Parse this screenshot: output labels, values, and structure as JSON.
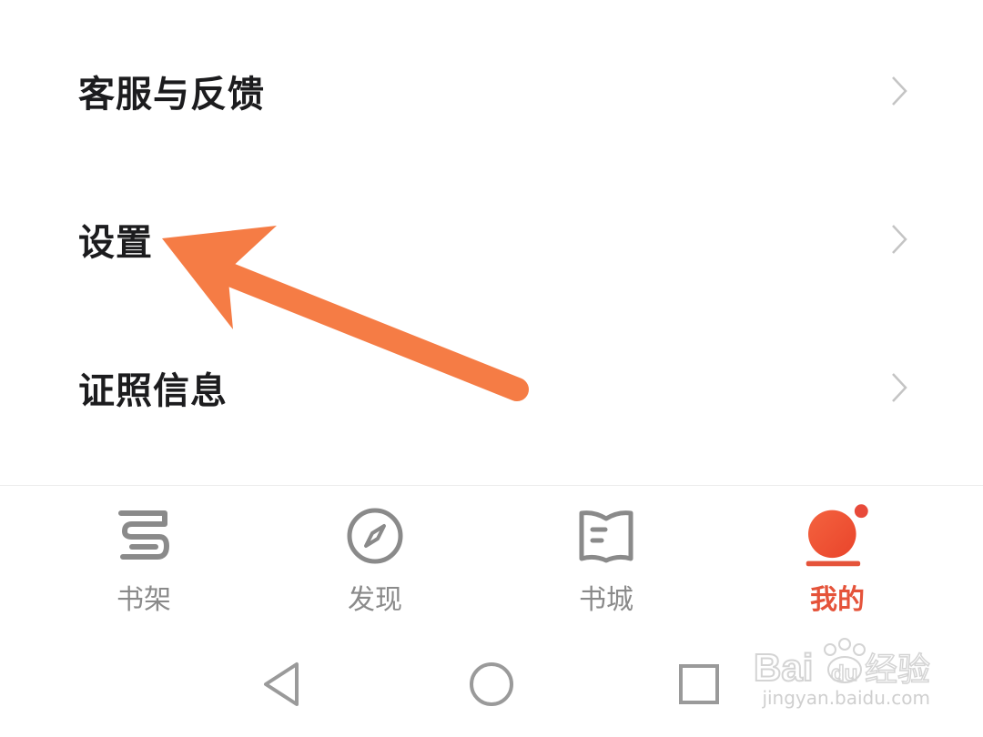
{
  "menu": {
    "items": [
      {
        "label": "客服与反馈"
      },
      {
        "label": "设置"
      },
      {
        "label": "证照信息"
      }
    ]
  },
  "tabs": [
    {
      "label": "书架",
      "icon": "bookshelf-icon",
      "active": false
    },
    {
      "label": "发现",
      "icon": "compass-icon",
      "active": false
    },
    {
      "label": "书城",
      "icon": "book-store-icon",
      "active": false
    },
    {
      "label": "我的",
      "icon": "profile-icon",
      "active": true
    }
  ],
  "colors": {
    "accent": "#e5533a",
    "arrow": "#f57c45",
    "inactive": "#8a8a8a",
    "text": "#1c1c1e"
  },
  "system_nav": [
    "back-icon",
    "home-icon",
    "recents-icon"
  ],
  "watermark": {
    "brand": "Bai du 经验",
    "url": "jingyan.baidu.com"
  }
}
